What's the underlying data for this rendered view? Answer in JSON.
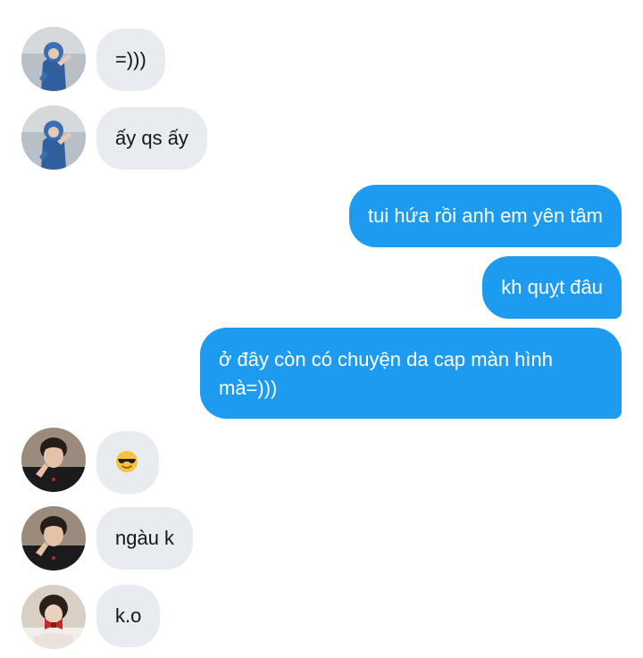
{
  "messages": [
    {
      "id": "m1",
      "direction": "incoming",
      "sender_avatar": "avatar-blue-hoodie",
      "text": "=)))"
    },
    {
      "id": "m2",
      "direction": "incoming",
      "sender_avatar": "avatar-blue-hoodie",
      "text": "ấy qs ấy"
    },
    {
      "id": "m3",
      "direction": "outgoing",
      "text": "tui hứa rồi anh em yên tâm"
    },
    {
      "id": "m4",
      "direction": "outgoing",
      "text": "kh quỵt đâu"
    },
    {
      "id": "m5",
      "direction": "outgoing",
      "text": "ở đây còn có chuyện da cap màn hình mà=)))"
    },
    {
      "id": "m6",
      "direction": "incoming",
      "sender_avatar": "avatar-dark-hair",
      "text": "",
      "emoji": "smiling-face-with-sunglasses-icon"
    },
    {
      "id": "m7",
      "direction": "incoming",
      "sender_avatar": "avatar-dark-hair",
      "text": "ngàu k"
    },
    {
      "id": "m8",
      "direction": "incoming",
      "sender_avatar": "avatar-red-bow",
      "text": "k.o"
    }
  ],
  "colors": {
    "outgoing_bubble": "#1d9bf0",
    "incoming_bubble": "#e8ebef",
    "incoming_text": "#14171a",
    "outgoing_text": "#ffffff"
  }
}
